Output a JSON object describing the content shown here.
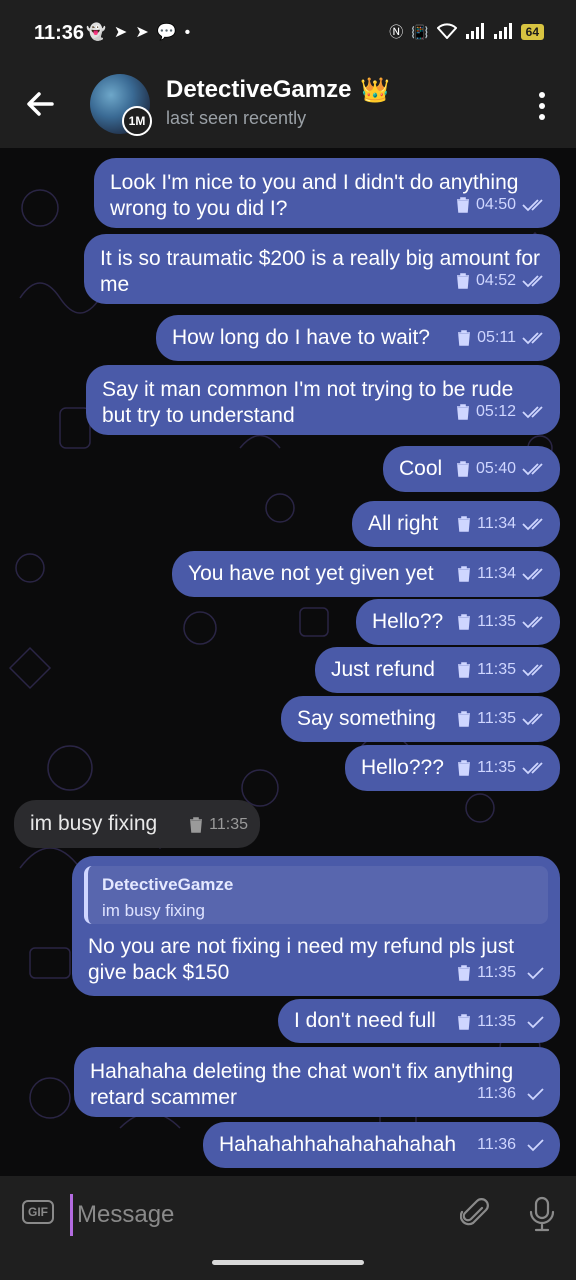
{
  "status_bar": {
    "time": "11:36",
    "left_icons": [
      "snapchat-icon",
      "navigation-icon",
      "telegram-icon",
      "chat-icon",
      "dot-icon"
    ],
    "right_icons": [
      "nfc-icon",
      "vibrate-icon",
      "volte-icon",
      "wifi-icon",
      "signal-icon",
      "signal-icon"
    ],
    "battery": "64"
  },
  "header": {
    "contact_name": "DetectiveGamze",
    "badge_emoji": "👑",
    "last_seen": "last seen recently",
    "story_badge": "1M"
  },
  "messages": [
    {
      "text": "Look I'm nice to you and I didn't do anything wrong to you did I?",
      "time": "04:50",
      "read": true
    },
    {
      "text": "It is so traumatic $200 is a really big amount for me",
      "time": "04:52",
      "read": true
    },
    {
      "text": "How long do I have to wait?",
      "time": "05:11",
      "read": true
    },
    {
      "text": "Say it man common I'm not trying to be rude but try to understand",
      "time": "05:12",
      "read": true
    },
    {
      "text": "Cool",
      "time": "05:40",
      "read": true
    },
    {
      "text": "All right",
      "time": "11:34",
      "read": true
    },
    {
      "text": "You have not yet given yet",
      "time": "11:34",
      "read": true
    },
    {
      "text": "Hello??",
      "time": "11:35",
      "read": true
    },
    {
      "text": "Just refund",
      "time": "11:35",
      "read": true
    },
    {
      "text": "Say something",
      "time": "11:35",
      "read": true
    },
    {
      "text": "Hello???",
      "time": "11:35",
      "read": true
    },
    {
      "text": "im busy fixing",
      "time": "11:35",
      "incoming": true
    },
    {
      "text": "No you are not fixing i need my refund pls just give back $150",
      "time": "11:35",
      "read": false,
      "reply_to": {
        "name": "DetectiveGamze",
        "text": "im busy fixing"
      }
    },
    {
      "text": "I don't need full",
      "time": "11:35",
      "read": false
    },
    {
      "text": "Hahahaha deleting the chat won't fix anything retard scammer",
      "time": "11:36",
      "read": false
    },
    {
      "text": "Hahahahhahahahahahah",
      "time": "11:36",
      "read": false
    }
  ],
  "input": {
    "placeholder": "Message",
    "gif_label": "GIF"
  },
  "colors": {
    "outgoing_bubble": "#4a5aa8",
    "incoming_bubble": "#2b2b2e",
    "bar_background": "#1f1f1f",
    "cursor": "#b36be0"
  }
}
